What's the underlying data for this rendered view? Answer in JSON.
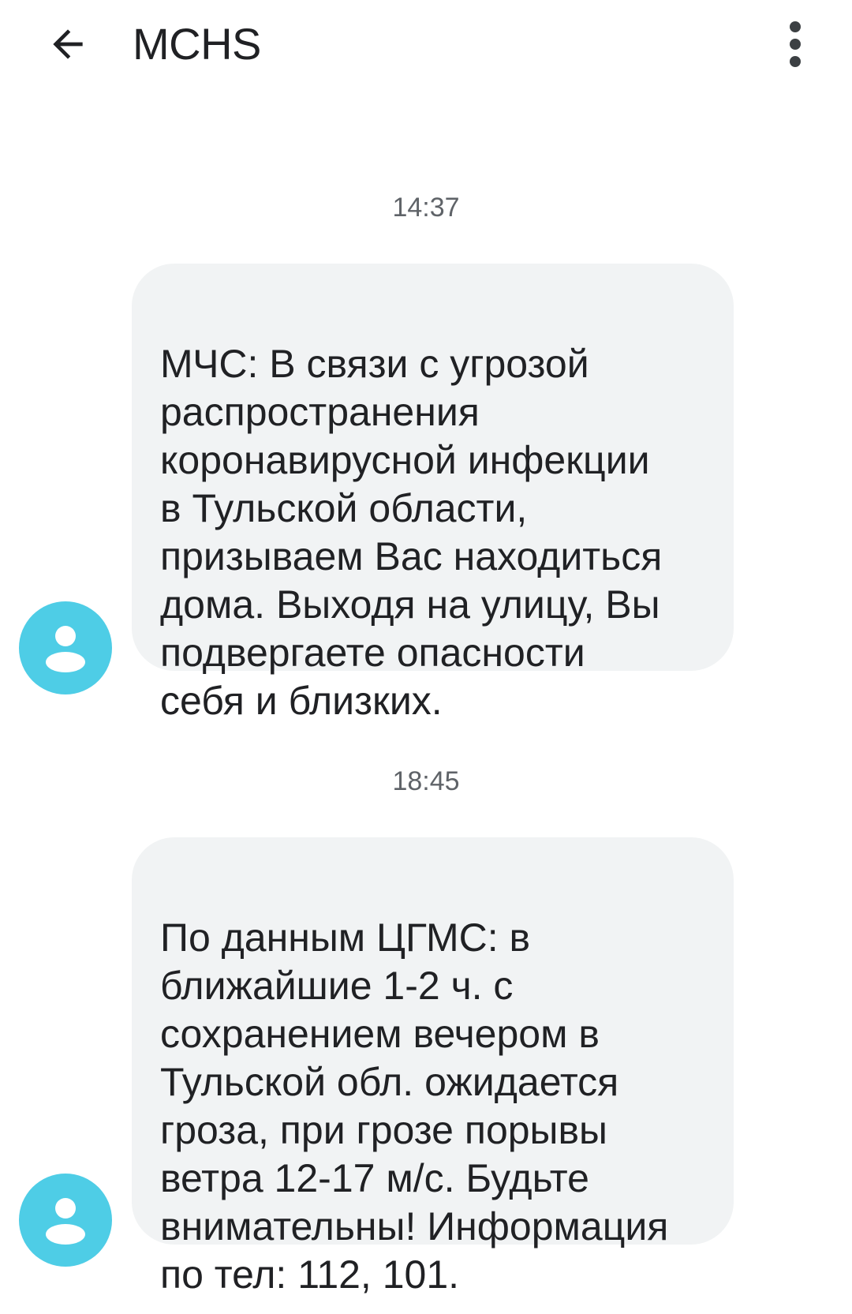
{
  "header": {
    "back_icon": "arrow-back-icon",
    "title": "MCHS",
    "menu_icon": "more-vert-icon"
  },
  "messages": [
    {
      "timestamp": "14:37",
      "avatar_icon": "person-icon",
      "avatar_color": "#4ecde6",
      "text": "МЧС: В связи с угрозой\nраспространения\nкоронавирусной инфекции\nв Тульской области,\nпризываем Вас находиться\nдома. Выходя на улицу, Вы\nподвергаете опасности\nсебя и близких."
    },
    {
      "timestamp": "18:45",
      "avatar_icon": "person-icon",
      "avatar_color": "#4ecde6",
      "text": "По данным ЦГМС: в\nближайшие 1-2 ч. с\nсохранением вечером в\nТульской обл. ожидается\nгроза, при грозе порывы\nветра 12-17 м/с. Будьте\nвнимательны! Информация\nпо тел: 112, 101."
    }
  ],
  "colors": {
    "bubble_bg": "#f1f3f4",
    "timestamp": "#5f6368",
    "text": "#202124"
  }
}
